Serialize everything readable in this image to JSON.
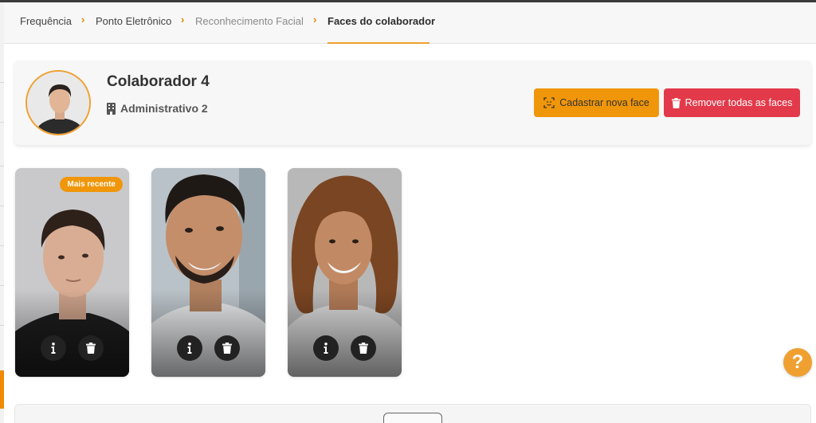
{
  "breadcrumb": {
    "items": [
      "Frequência",
      "Ponto Eletrônico",
      "Reconhecimento Facial",
      "Faces do colaborador"
    ],
    "separator": "›"
  },
  "employee": {
    "name": "Colaborador 4",
    "department": "Administrativo 2"
  },
  "actions": {
    "register_label": "Cadastrar nova face",
    "remove_all_label": "Remover todas as faces"
  },
  "faces": [
    {
      "badge": "Mais recente",
      "info_icon": "info-icon",
      "delete_icon": "trash-icon"
    },
    {
      "badge": "",
      "info_icon": "info-icon",
      "delete_icon": "trash-icon"
    },
    {
      "badge": "",
      "info_icon": "info-icon",
      "delete_icon": "trash-icon"
    }
  ],
  "help": {
    "label": "?"
  },
  "colors": {
    "accent": "#f0960a",
    "danger": "#e23a4a",
    "badge": "#f0960a"
  }
}
